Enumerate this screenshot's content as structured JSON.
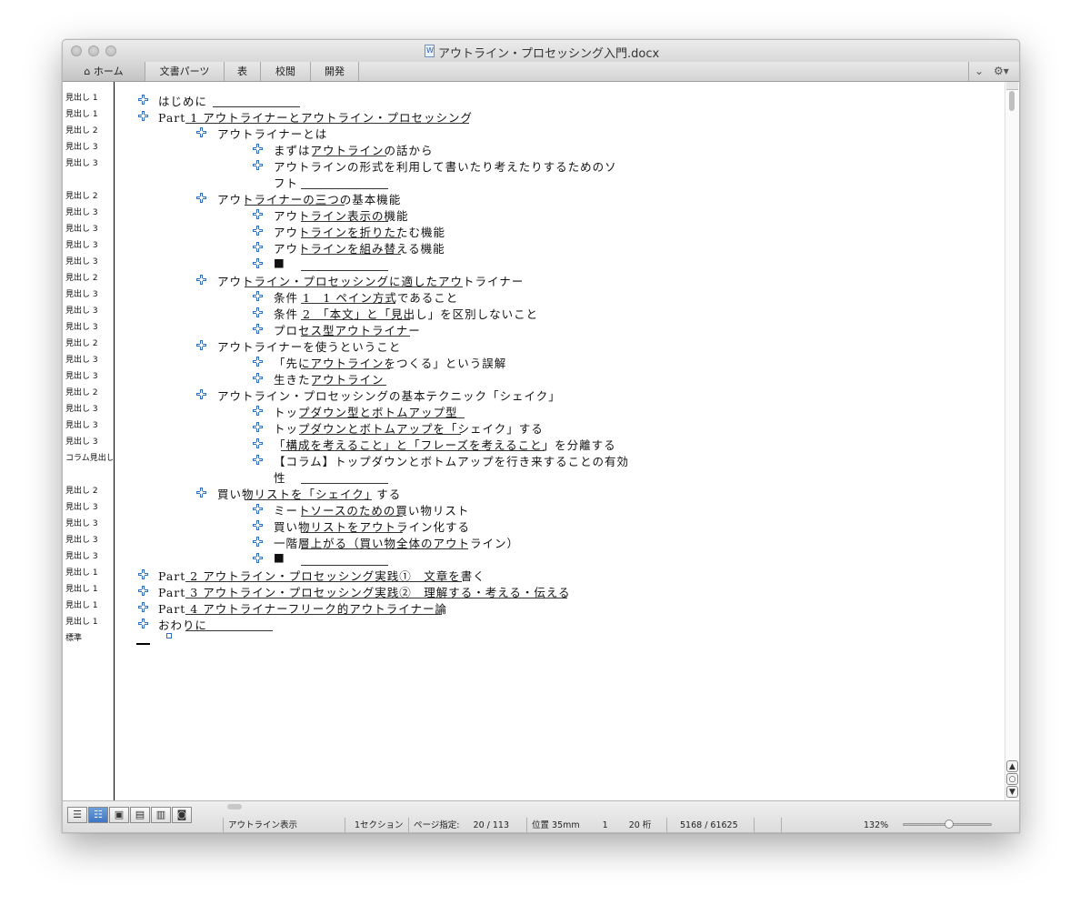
{
  "window": {
    "title": "アウトライン・プロセッシング入門.docx"
  },
  "ribbon": {
    "tabs": [
      {
        "label": "ホーム",
        "icon": "home-icon"
      },
      {
        "label": "文書パーツ"
      },
      {
        "label": "表"
      },
      {
        "label": "校閲"
      },
      {
        "label": "開発"
      }
    ]
  },
  "outline": {
    "rows": [
      {
        "style": "見出し 1",
        "text": "はじめに"
      },
      {
        "style": "見出し 1",
        "text": "Part 1 アウトライナーとアウトライン・プロセッシング"
      },
      {
        "style": "見出し 2",
        "text": "アウトライナーとは"
      },
      {
        "style": "見出し 3",
        "text": "まずはアウトラインの話から"
      },
      {
        "style": "見出し 3",
        "text": "アウトラインの形式を利用して書いたり考えたりするためのソ"
      },
      {
        "style": "",
        "text": "フト"
      },
      {
        "style": "見出し 2",
        "text": "アウトライナーの三つの基本機能"
      },
      {
        "style": "見出し 3",
        "text": "アウトライン表示の機能"
      },
      {
        "style": "見出し 3",
        "text": "アウトラインを折りたたむ機能"
      },
      {
        "style": "見出し 3",
        "text": "アウトラインを組み替える機能"
      },
      {
        "style": "見出し 3",
        "text": "■"
      },
      {
        "style": "見出し 2",
        "text": "アウトライン・プロセッシングに適したアウトライナー"
      },
      {
        "style": "見出し 3",
        "text": "条件 1　1 ペイン方式であること"
      },
      {
        "style": "見出し 3",
        "text": "条件 2　「本文」と「見出し」を区別しないこと"
      },
      {
        "style": "見出し 3",
        "text": "プロセス型アウトライナー"
      },
      {
        "style": "見出し 2",
        "text": "アウトライナーを使うということ"
      },
      {
        "style": "見出し 3",
        "text": "「先にアウトラインをつくる」という誤解"
      },
      {
        "style": "見出し 3",
        "text": "生きたアウトライン"
      },
      {
        "style": "見出し 2",
        "text": "アウトライン・プロセッシングの基本テクニック「シェイク」"
      },
      {
        "style": "見出し 3",
        "text": "トップダウン型とボトムアップ型"
      },
      {
        "style": "見出し 3",
        "text": "トップダウンとボトムアップを「シェイク」する"
      },
      {
        "style": "見出し 3",
        "text": "「構成を考えること」と「フレーズを考えること」を分離する"
      },
      {
        "style": "コラム見出し",
        "text": "【コラム】トップダウンとボトムアップを行き来することの有効"
      },
      {
        "style": "",
        "text": "性"
      },
      {
        "style": "見出し 2",
        "text": "買い物リストを「シェイク」する"
      },
      {
        "style": "見出し 3",
        "text": "ミートソースのための買い物リスト"
      },
      {
        "style": "見出し 3",
        "text": "買い物リストをアウトライン化する"
      },
      {
        "style": "見出し 3",
        "text": "一階層上がる（買い物全体のアウトライン）"
      },
      {
        "style": "見出し 3",
        "text": "■"
      },
      {
        "style": "見出し 1",
        "text": "Part 2 アウトライン・プロセッシング実践①　文章を書く"
      },
      {
        "style": "見出し 1",
        "text": "Part 3 アウトライン・プロセッシング実践②　理解する・考える・伝える"
      },
      {
        "style": "見出し 1",
        "text": "Part 4 アウトライナーフリーク的アウトライナー論"
      },
      {
        "style": "見出し 1",
        "text": "おわりに"
      },
      {
        "style": "標準",
        "text": ""
      }
    ]
  },
  "statusbar": {
    "view_mode": "アウトライン表示",
    "section": "1セクション",
    "page_label": "ページ指定:",
    "page": "20 / 113",
    "position": "位置 35mm",
    "line": "1",
    "column": "20 桁",
    "word_count": "5168 / 61625",
    "zoom": "132%"
  },
  "colors": {
    "outline_plus": "#2f6fbf",
    "active_view_button": "#3d76c4"
  }
}
